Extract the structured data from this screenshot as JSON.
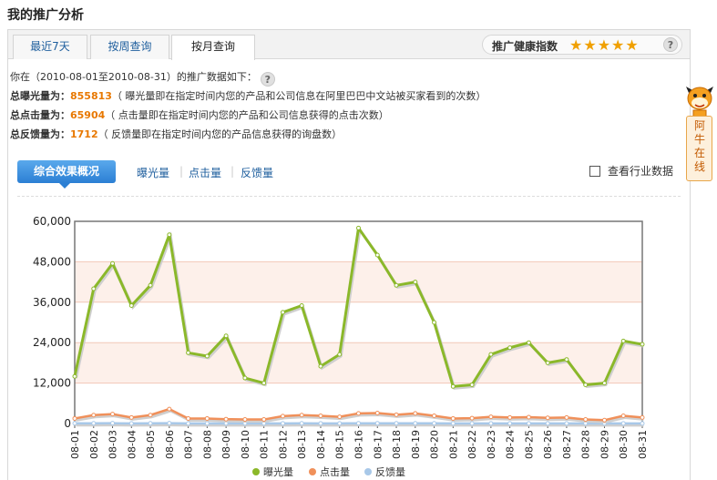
{
  "page": {
    "title": "我的推广分析"
  },
  "tabs": [
    {
      "label": "最近7天"
    },
    {
      "label": "按周查询"
    },
    {
      "label": "按月查询",
      "active": true
    }
  ],
  "health": {
    "label": "推广健康指数",
    "stars": "★★★★★",
    "rating": 5,
    "help": "?"
  },
  "info": {
    "range_prefix": "你在（",
    "range": "2010-08-01至2010-08-31",
    "range_suffix": "）的推广数据如下：",
    "help": "?",
    "impressions_label": "总曝光量为：",
    "impressions_value": "855813",
    "impressions_desc": "（ 曝光量即在指定时间内您的产品和公司信息在阿里巴巴中文站被买家看到的次数）",
    "clicks_label": "总点击量为：",
    "clicks_value": "65904",
    "clicks_desc": "（ 点击量即在指定时间内您的产品和公司信息获得的点击次数）",
    "feedback_label": "总反馈量为：",
    "feedback_value": "1712",
    "feedback_desc": "（ 反馈量即在指定时间内您的产品信息获得的询盘数）"
  },
  "subbar": {
    "summary": "综合效果概况",
    "links": [
      "曝光量",
      "点击量",
      "反馈量"
    ],
    "industry": "查看行业数据"
  },
  "side": {
    "text": "阿牛在线"
  },
  "colors": {
    "impressions": "#8bb82a",
    "clicks": "#f0905a",
    "feedback": "#a8c8e8",
    "orange": "#e87800",
    "link": "#1f5f9e"
  },
  "chart_data": {
    "type": "line",
    "categories": [
      "08-01",
      "08-02",
      "08-03",
      "08-04",
      "08-05",
      "08-06",
      "08-07",
      "08-08",
      "08-09",
      "08-10",
      "08-11",
      "08-12",
      "08-13",
      "08-14",
      "08-15",
      "08-16",
      "08-17",
      "08-18",
      "08-19",
      "08-20",
      "08-21",
      "08-22",
      "08-23",
      "08-24",
      "08-25",
      "08-26",
      "08-27",
      "08-28",
      "08-29",
      "08-30",
      "08-31"
    ],
    "yticks": [
      0,
      12000,
      24000,
      36000,
      48000,
      60000
    ],
    "ytick_labels": [
      "0",
      "12,000",
      "24,000",
      "36,000",
      "48,000",
      "60,000"
    ],
    "ylim": [
      0,
      60000
    ],
    "legend_position": "bottom",
    "series": [
      {
        "name": "曝光量",
        "color": "#8bb82a",
        "values": [
          14000,
          40000,
          47500,
          35000,
          41000,
          56000,
          21000,
          20000,
          26000,
          13500,
          12000,
          33000,
          35000,
          17000,
          20500,
          58000,
          50000,
          41000,
          42000,
          30000,
          11000,
          11500,
          20500,
          22500,
          24000,
          18000,
          19000,
          11500,
          12000,
          24500,
          23500
        ]
      },
      {
        "name": "点击量",
        "color": "#f0905a",
        "values": [
          1500,
          2500,
          2800,
          1800,
          2500,
          4300,
          1500,
          1500,
          1300,
          1200,
          1200,
          2200,
          2500,
          2300,
          2000,
          3000,
          3100,
          2600,
          3000,
          2300,
          1500,
          1600,
          2000,
          1800,
          1900,
          1700,
          1800,
          1200,
          1000,
          2300,
          1800
        ]
      },
      {
        "name": "反馈量",
        "color": "#a8c8e8",
        "values": [
          60,
          70,
          90,
          50,
          60,
          100,
          40,
          40,
          40,
          30,
          30,
          50,
          60,
          50,
          50,
          80,
          80,
          60,
          70,
          60,
          40,
          40,
          50,
          50,
          50,
          40,
          40,
          30,
          30,
          50,
          40
        ]
      }
    ]
  }
}
